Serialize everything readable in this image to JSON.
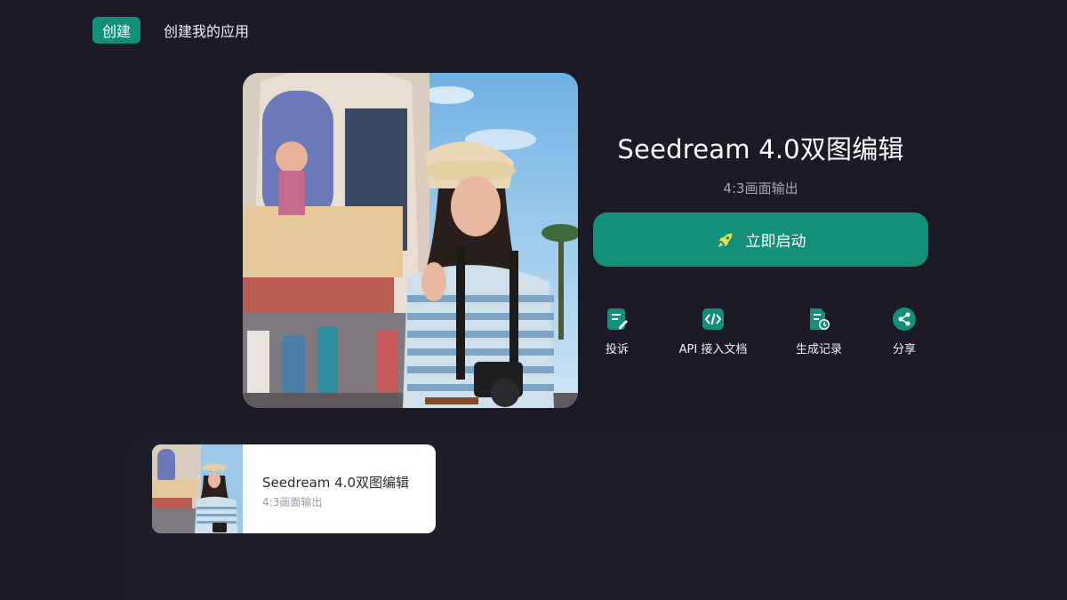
{
  "nav": {
    "create_tab": "创建",
    "my_apps_link": "创建我的应用"
  },
  "app": {
    "title": "Seedream 4.0双图编辑",
    "subtitle": "4:3画面输出"
  },
  "launch": {
    "label": "立即启动",
    "icon": "rocket-icon"
  },
  "actions": [
    {
      "label": "投诉",
      "icon": "report-edit-icon"
    },
    {
      "label": "API 接入文档",
      "icon": "code-icon"
    },
    {
      "label": "生成记录",
      "icon": "history-doc-icon"
    },
    {
      "label": "分享",
      "icon": "share-icon"
    }
  ],
  "card": {
    "title": "Seedream 4.0双图编辑",
    "subtitle": "4:3画面输出"
  },
  "colors": {
    "background": "#1b1a26",
    "accent": "#14907a",
    "rocket": "#f4e04d"
  }
}
